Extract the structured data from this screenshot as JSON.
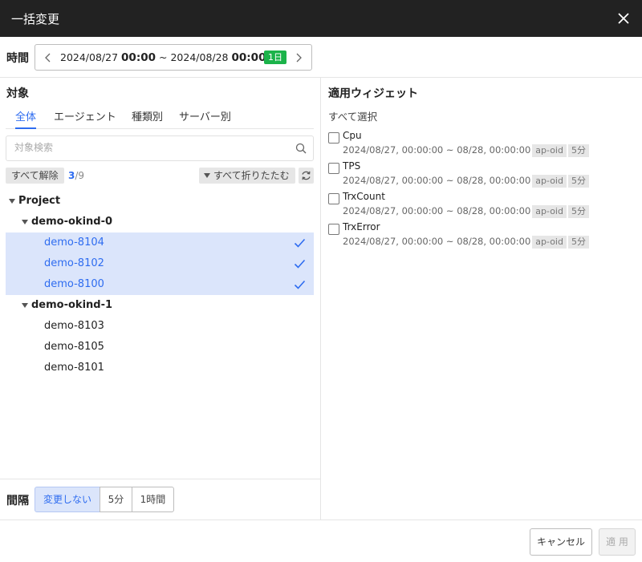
{
  "dialog": {
    "title": "一括変更"
  },
  "time": {
    "label": "時間",
    "start_date": "2024/08/27",
    "start_time": "00:00",
    "separator": "~",
    "end_date": "2024/08/28",
    "end_time": "00:00",
    "duration_badge": "1日",
    "badge_color": "#1bb34a"
  },
  "target": {
    "title": "対象",
    "tabs": [
      {
        "label": "全体",
        "active": true
      },
      {
        "label": "エージェント",
        "active": false
      },
      {
        "label": "種類別",
        "active": false
      },
      {
        "label": "サーバー別",
        "active": false
      }
    ],
    "search_placeholder": "対象検索",
    "deselect_all_label": "すべて解除",
    "selected_count": "3",
    "total_count": "/9",
    "collapse_all_label": "すべて折りたたむ",
    "tree": {
      "root": "Project",
      "groups": [
        {
          "name": "demo-okind-0",
          "items": [
            {
              "name": "demo-8104",
              "selected": true
            },
            {
              "name": "demo-8102",
              "selected": true
            },
            {
              "name": "demo-8100",
              "selected": true
            }
          ]
        },
        {
          "name": "demo-okind-1",
          "items": [
            {
              "name": "demo-8103",
              "selected": false
            },
            {
              "name": "demo-8105",
              "selected": false
            },
            {
              "name": "demo-8101",
              "selected": false
            }
          ]
        }
      ]
    },
    "accent_color": "#2e6cf0",
    "selection_color": "#dbe5fb"
  },
  "interval": {
    "label": "間隔",
    "options": [
      {
        "label": "変更しない",
        "active": true
      },
      {
        "label": "5分",
        "active": false
      },
      {
        "label": "1時間",
        "active": false
      }
    ]
  },
  "widgets": {
    "title": "適用ウィジェット",
    "select_all_label": "すべて選択",
    "items": [
      {
        "name": "Cpu",
        "range": "2024/08/27, 00:00:00 ~ 08/28, 00:00:00",
        "tag1": "ap-oid",
        "tag2": "5分",
        "checked": false
      },
      {
        "name": "TPS",
        "range": "2024/08/27, 00:00:00 ~ 08/28, 00:00:00",
        "tag1": "ap-oid",
        "tag2": "5分",
        "checked": false
      },
      {
        "name": "TrxCount",
        "range": "2024/08/27, 00:00:00 ~ 08/28, 00:00:00",
        "tag1": "ap-oid",
        "tag2": "5分",
        "checked": false
      },
      {
        "name": "TrxError",
        "range": "2024/08/27, 00:00:00 ~ 08/28, 00:00:00",
        "tag1": "ap-oid",
        "tag2": "5分",
        "checked": false
      }
    ]
  },
  "footer": {
    "cancel_label": "キャンセル",
    "apply_label": "適 用"
  },
  "icons": {
    "close": "close-icon",
    "prev": "chevron-left-icon",
    "next": "chevron-right-icon",
    "search": "search-icon",
    "refresh": "refresh-icon",
    "check": "check-icon",
    "caret": "caret-down-icon"
  }
}
